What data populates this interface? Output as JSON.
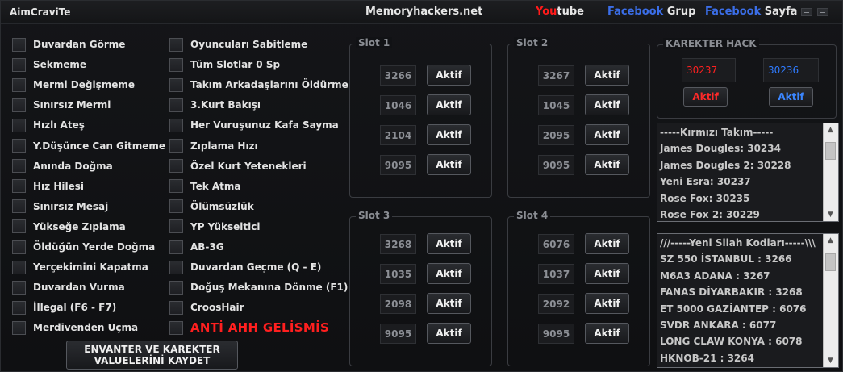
{
  "titlebar": {
    "app_title": "AimCraviTe",
    "site": "Memoryhackers.net",
    "youtube_red": "You",
    "youtube_rest": "tube",
    "facebook_grup_word": "Facebook",
    "facebook_grup_rest": " Grup",
    "facebook_sayfa_word": "Facebook",
    "facebook_sayfa_rest": " Sayfa"
  },
  "cheats_left": [
    "Duvardan Görme",
    "Sekmeme",
    "Mermi Değişmeme",
    "Sınırsız Mermi",
    "Hızlı Ateş",
    "Y.Düşünce Can Gitmeme",
    "Anında Doğma",
    "Hız Hilesi",
    "Sınırsız Mesaj",
    "Yükseğe Zıplama",
    "Öldüğün Yerde Doğma",
    "Yerçekimini Kapatma",
    "Duvardan Vurma",
    "İllegal (F6 - F7)",
    "Merdivenden Uçma"
  ],
  "cheats_right": [
    "Oyuncuları Sabitleme",
    "Tüm Slotlar 0 Sp",
    "Takım Arkadaşlarını Öldürme",
    "3.Kurt Bakışı",
    "Her Vuruşunuz Kafa Sayma",
    "Zıplama Hızı",
    "Özel Kurt Yetenekleri",
    "Tek Atma",
    "Ölümsüzlük",
    "YP Yükseltici",
    "AB-3G",
    "Duvardan Geçme (Q - E)",
    "Doğuş Mekanına Dönme (F1)",
    "CroosHair",
    "ANTİ AHH GELİSMİS"
  ],
  "slots": [
    {
      "title": "Slot 1",
      "values": [
        "3266",
        "1046",
        "2104",
        "9095"
      ]
    },
    {
      "title": "Slot 2",
      "values": [
        "3267",
        "1045",
        "2095",
        "9095"
      ]
    },
    {
      "title": "Slot 3",
      "values": [
        "3268",
        "1035",
        "2098",
        "9095"
      ]
    },
    {
      "title": "Slot 4",
      "values": [
        "6076",
        "1037",
        "2092",
        "9095"
      ]
    }
  ],
  "aktif_label": "Aktif",
  "karakter_hack": {
    "title": "KAREKTER HACK",
    "red_value": "30237",
    "blue_value": "30236",
    "red_button": "Aktif",
    "blue_button": "Aktif",
    "red_color": "#ff2020",
    "blue_color": "#2f7bff"
  },
  "team_list": [
    "-----Kırmızı Takım-----",
    "James Dougles: 30234",
    "James Dougles 2: 30228",
    "Yeni Esra: 30237",
    "Rose Fox: 30235",
    "Rose Fox 2: 30229"
  ],
  "weapon_list": [
    "///-----Yeni Silah Kodları-----\\\\\\",
    "SZ 550 İSTANBUL : 3266",
    "M6A3 ADANA : 3267",
    "FANAS DİYARBAKIR : 3268",
    "ET 5000 GAZİANTEP : 6076",
    "SVDR ANKARA : 6077",
    "LONG CLAW KONYA : 6078",
    "HKNOB-21 : 3264"
  ],
  "save_button": {
    "line1": "ENVANTER VE KAREKTER",
    "line2": "VALUELERİNİ KAYDET"
  },
  "icons": {
    "minimize": "minimize-icon",
    "close": "close-icon",
    "scroll_up": "scroll-up-arrow-icon",
    "scroll_down": "scroll-down-arrow-icon"
  },
  "colors": {
    "anti_ahh": "#ff1f1f",
    "youtube_red": "#ff1a1a",
    "facebook_blue": "#3b6ee8"
  }
}
